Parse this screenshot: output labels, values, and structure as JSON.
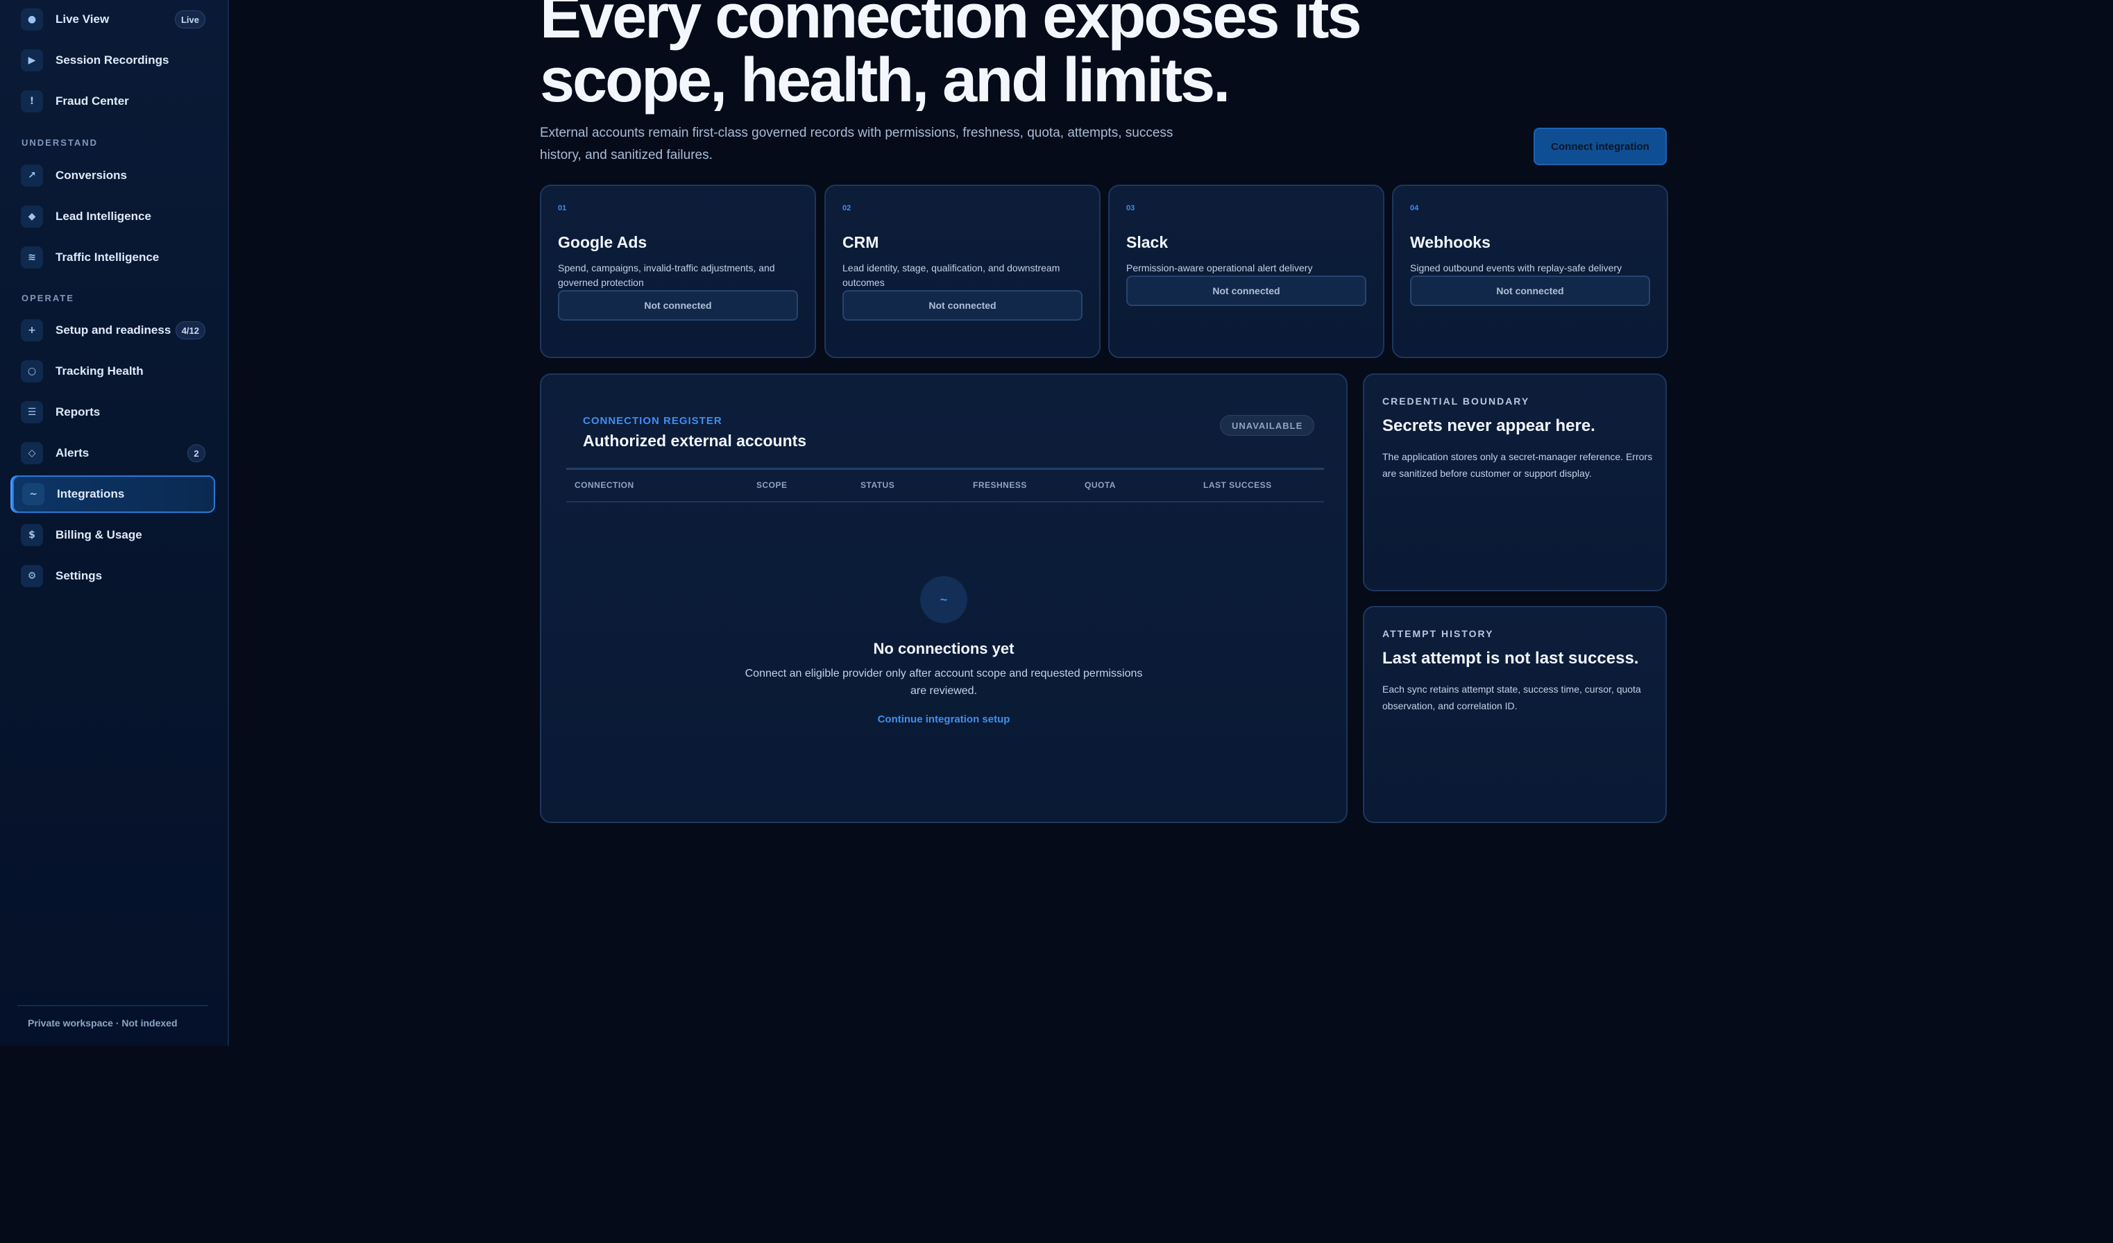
{
  "sidebar": {
    "items": [
      {
        "icon": "●",
        "label": "Live View",
        "badge": "Live"
      },
      {
        "icon": "▶",
        "label": "Session Recordings",
        "badge": ""
      },
      {
        "icon": "!",
        "label": "Fraud Center",
        "badge": ""
      },
      {
        "icon": "↗",
        "label": "Conversions",
        "badge": ""
      },
      {
        "icon": "◆",
        "label": "Lead Intelligence",
        "badge": ""
      },
      {
        "icon": "≋",
        "label": "Traffic Intelligence",
        "badge": ""
      },
      {
        "icon": "+",
        "label": "Setup and readiness",
        "badge": "4/12"
      },
      {
        "icon": "○",
        "label": "Tracking Health",
        "badge": ""
      },
      {
        "icon": "☰",
        "label": "Reports",
        "badge": ""
      },
      {
        "icon": "◇",
        "label": "Alerts",
        "badge": "2"
      },
      {
        "icon": "~",
        "label": "Integrations",
        "badge": ""
      },
      {
        "icon": "$",
        "label": "Billing & Usage",
        "badge": ""
      },
      {
        "icon": "⚙",
        "label": "Settings",
        "badge": ""
      }
    ],
    "sections": {
      "understand": "UNDERSTAND",
      "operate": "OPERATE"
    },
    "footer": "Private workspace · Not indexed"
  },
  "header": {
    "title": "Every connection exposes its scope, health, and limits.",
    "subtitle": "External accounts remain first-class governed records with permissions, freshness, quota, attempts, success history, and sanitized failures.",
    "connect_button": "Connect integration"
  },
  "providers": [
    {
      "num": "01",
      "name": "Google Ads",
      "desc": "Spend, campaigns, invalid-traffic adjustments, and governed protection",
      "status": "Not connected"
    },
    {
      "num": "02",
      "name": "CRM",
      "desc": "Lead identity, stage, qualification, and downstream outcomes",
      "status": "Not connected"
    },
    {
      "num": "03",
      "name": "Slack",
      "desc": "Permission-aware operational alert delivery",
      "status": "Not connected"
    },
    {
      "num": "04",
      "name": "Webhooks",
      "desc": "Signed outbound events with replay-safe delivery",
      "status": "Not connected"
    }
  ],
  "register": {
    "kicker": "CONNECTION REGISTER",
    "title": "Authorized external accounts",
    "badge": "UNAVAILABLE",
    "columns": [
      "CONNECTION",
      "SCOPE",
      "STATUS",
      "FRESHNESS",
      "QUOTA",
      "LAST SUCCESS"
    ],
    "empty": {
      "icon": "~",
      "title": "No connections yet",
      "desc": "Connect an eligible provider only after account scope and requested permissions are reviewed.",
      "link": "Continue integration setup"
    }
  },
  "credential": {
    "kicker": "CREDENTIAL BOUNDARY",
    "title": "Secrets never appear here.",
    "desc": "The application stores only a secret-manager reference. Errors are sanitized before customer or support display."
  },
  "attempts": {
    "kicker": "ATTEMPT HISTORY",
    "title": "Last attempt is not last success.",
    "desc": "Each sync retains attempt state, success time, cursor, quota observation, and correlation ID."
  },
  "colors": {
    "accent": "#3f8ef0",
    "background": "#050b18",
    "card": "#0b1b37",
    "active_nav": "#2a78d6"
  }
}
